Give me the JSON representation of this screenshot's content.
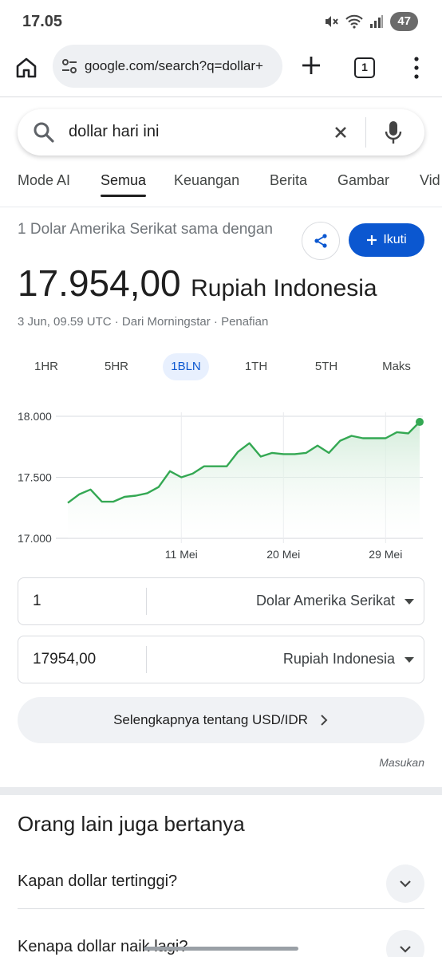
{
  "status_bar": {
    "time": "17.05",
    "battery": "47"
  },
  "browser": {
    "url": "google.com/search?q=dollar+",
    "tab_count": "1"
  },
  "search": {
    "query": "dollar hari ini"
  },
  "category_tabs": [
    "Mode AI",
    "Semua",
    "Keuangan",
    "Berita",
    "Gambar",
    "Vid"
  ],
  "currency": {
    "subtitle": "1 Dolar Amerika Serikat sama dengan",
    "value": "17.954,00",
    "unit": "Rupiah Indonesia",
    "meta": "3 Jun, 09.59 UTC · Dari Morningstar · Penafian",
    "follow_label": "Ikuti"
  },
  "ranges": [
    "1HR",
    "5HR",
    "1BLN",
    "1TH",
    "5TH",
    "Maks"
  ],
  "active_range": "1BLN",
  "chart_data": {
    "type": "area",
    "y_ticks": [
      "18.000",
      "17.500",
      "17.000"
    ],
    "x_ticks": [
      "11 Mei",
      "20 Mei",
      "29 Mei"
    ],
    "ylim": [
      17000,
      18000
    ],
    "values": [
      17290,
      17360,
      17400,
      17300,
      17300,
      17340,
      17350,
      17370,
      17420,
      17550,
      17500,
      17530,
      17590,
      17590,
      17590,
      17710,
      17780,
      17670,
      17700,
      17690,
      17690,
      17700,
      17760,
      17700,
      17800,
      17840,
      17820,
      17820,
      17820,
      17870,
      17860,
      17954
    ],
    "line_color": "#34a853",
    "fill_color": "#e6f4ea",
    "grid": true
  },
  "converter": {
    "from_amount": "1",
    "from_currency": "Dolar Amerika Serikat",
    "to_amount": "17954,00",
    "to_currency": "Rupiah Indonesia"
  },
  "more_button": "Selengkapnya tentang USD/IDR",
  "feedback": "Masukan",
  "paa": {
    "title": "Orang lain juga bertanya",
    "questions": [
      "Kapan dollar tertinggi?",
      "Kenapa dollar naik lagi?"
    ]
  }
}
